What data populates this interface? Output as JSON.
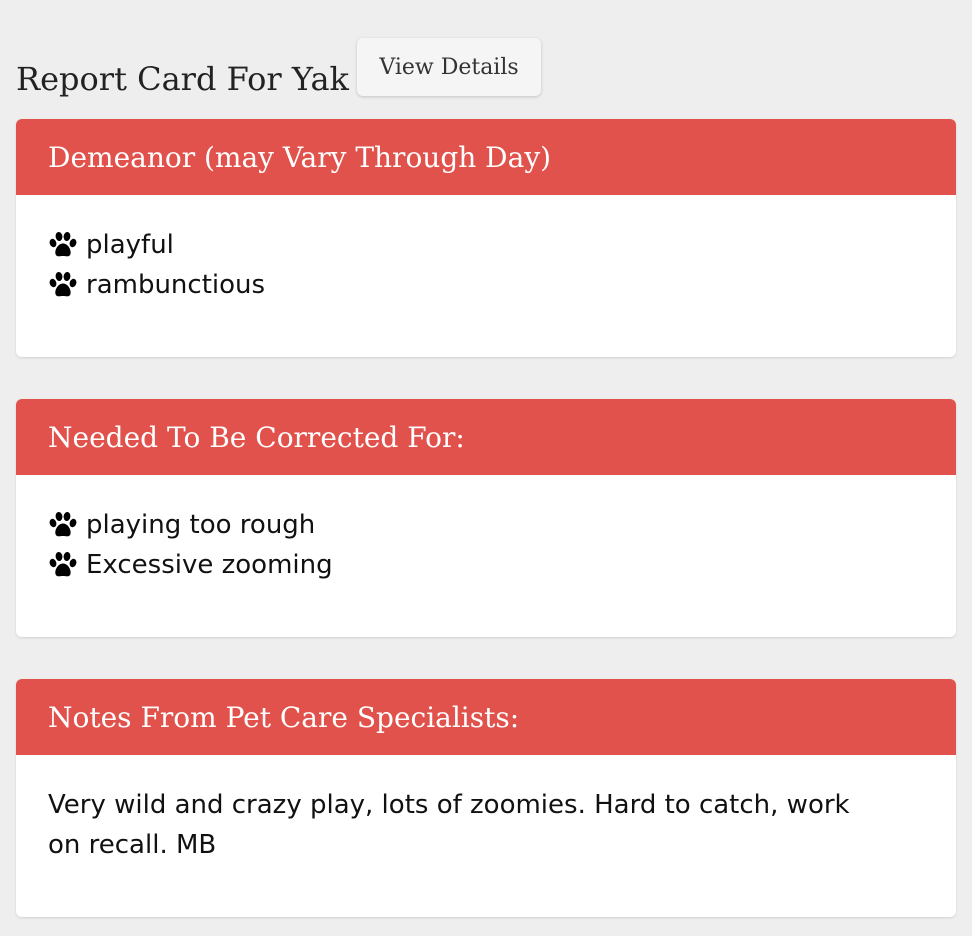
{
  "header": {
    "title": "Report Card For Yak",
    "view_details_label": "View Details"
  },
  "cards": [
    {
      "title": "Demeanor (may Vary Through Day)",
      "items": [
        {
          "icon": "paw-icon",
          "label": "playful"
        },
        {
          "icon": "paw-icon",
          "label": "rambunctious"
        }
      ]
    },
    {
      "title": "Needed To Be Corrected For:",
      "items": [
        {
          "icon": "paw-icon",
          "label": "playing too rough"
        },
        {
          "icon": "paw-icon",
          "label": "Excessive zooming"
        }
      ]
    },
    {
      "title": "Notes From Pet Care Specialists:",
      "notes": "Very wild and crazy play, lots of zoomies. Hard to catch, work on recall. MB"
    }
  ],
  "colors": {
    "accent": "#e0524b",
    "background": "#eeeeee",
    "card": "#ffffff"
  }
}
